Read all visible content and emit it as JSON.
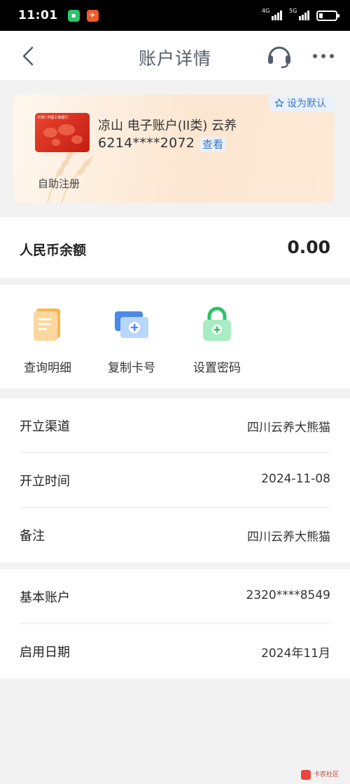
{
  "status_bar": {
    "time": "11:01",
    "network_1": "4G",
    "network_2": "5G"
  },
  "nav": {
    "title": "账户详情"
  },
  "card": {
    "bank_logo_text": "ICBC 中国工商银行",
    "account_name": "凉山 电子账户(II类) 云养",
    "account_number": "6214****2072",
    "view_label": "查看",
    "set_default_label": "设为默认",
    "self_register_label": "自助注册"
  },
  "balance": {
    "label": "人民币余额",
    "value": "0.00"
  },
  "actions": [
    {
      "label": "查询明细",
      "icon": "document-icon"
    },
    {
      "label": "复制卡号",
      "icon": "copy-card-icon"
    },
    {
      "label": "设置密码",
      "icon": "lock-icon"
    }
  ],
  "info_group_1": [
    {
      "key": "开立渠道",
      "value": "四川云养大熊猫"
    },
    {
      "key": "开立时间",
      "value": "2024-11-08"
    },
    {
      "key": "备注",
      "value": "四川云养大熊猫"
    }
  ],
  "info_group_2": [
    {
      "key": "基本账户",
      "value": "2320****8549"
    },
    {
      "key": "启用日期",
      "value": "2024年11月"
    }
  ],
  "watermark": {
    "text": "卡农社区"
  },
  "colors": {
    "accent_blue": "#3a78c9",
    "title_gray": "#555e6a",
    "card_bg": "#fbe6d1",
    "lock_green": "#3fd27a",
    "doc_orange": "#f6a623"
  }
}
